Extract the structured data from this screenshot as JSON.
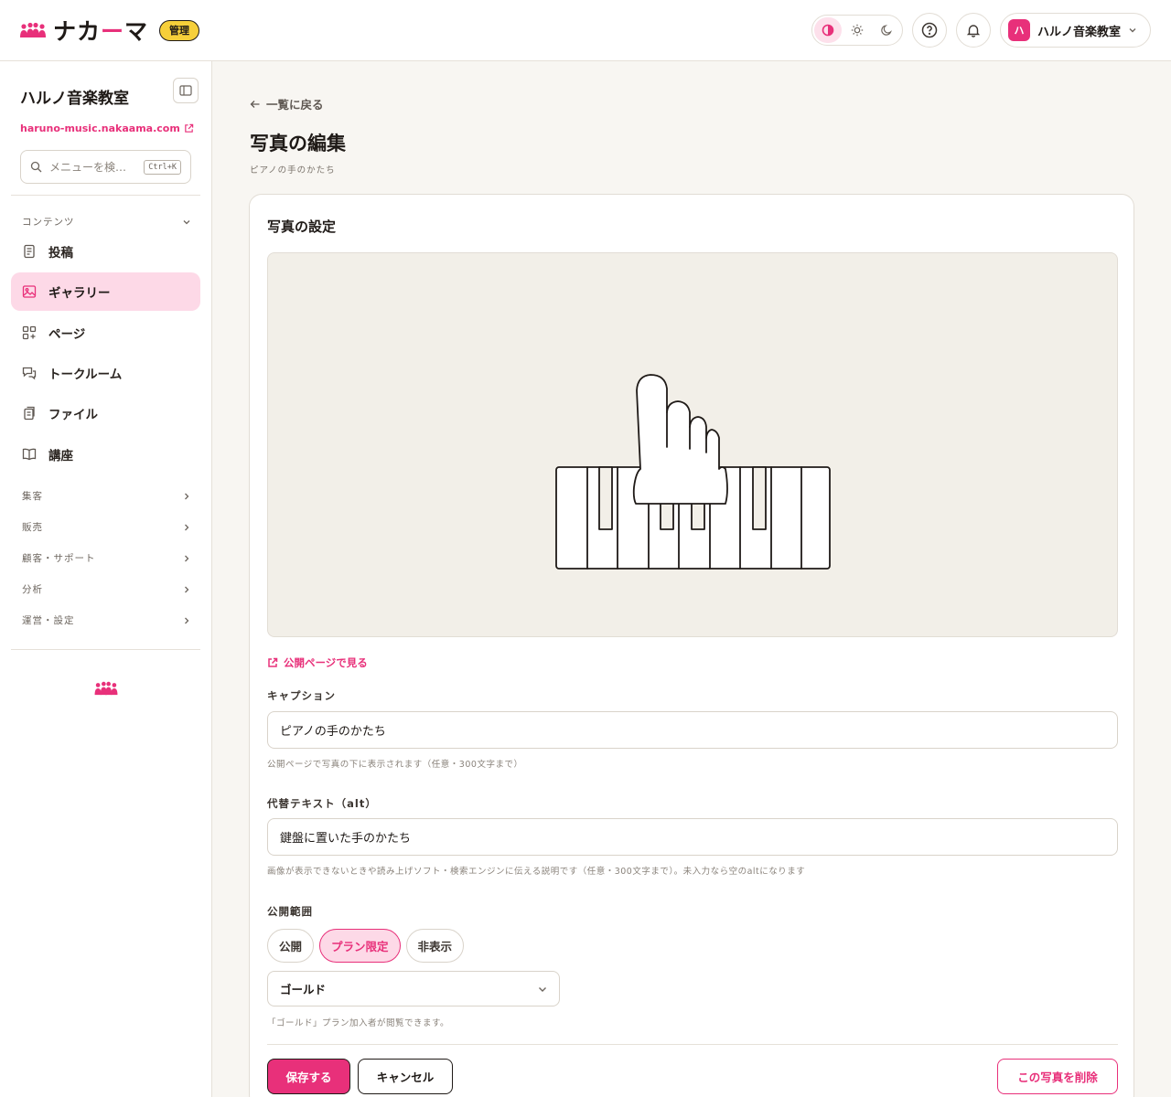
{
  "topbar": {
    "brand_name_main": "ナカ",
    "brand_name_bar": "ー",
    "brand_name_end": "マ",
    "admin_badge": "管理",
    "account_initial": "ハ",
    "account_name": "ハルノ音楽教室",
    "theme_options": [
      "contrast-icon",
      "sun-icon",
      "moon-icon"
    ],
    "accent_color": "#e8307a"
  },
  "sidebar": {
    "site_title": "ハルノ音楽教室",
    "site_url": "haruno-music.nakaama.com",
    "search_placeholder": "メニューを検…",
    "search_shortcut": "Ctrl+K",
    "section_contents": "コンテンツ",
    "items": [
      {
        "label": "投稿",
        "icon": "document-icon"
      },
      {
        "label": "ギャラリー",
        "icon": "image-icon",
        "active": true
      },
      {
        "label": "ページ",
        "icon": "pages-icon"
      },
      {
        "label": "トークルーム",
        "icon": "chat-icon"
      },
      {
        "label": "ファイル",
        "icon": "files-icon"
      },
      {
        "label": "講座",
        "icon": "book-icon"
      }
    ],
    "sections": [
      "集客",
      "販売",
      "顧客・サポート",
      "分析",
      "運営・設定"
    ]
  },
  "main": {
    "back_label": "一覧に戻る",
    "title": "写真の編集",
    "subtitle": "ピアノの手のかたち",
    "card_title": "写真の設定",
    "public_link": "公開ページで見る",
    "caption_label": "キャプション",
    "caption_value": "ピアノの手のかたち",
    "caption_help": "公開ページで写真の下に表示されます（任意・300文字まで）",
    "alt_label": "代替テキスト（alt）",
    "alt_value": "鍵盤に置いた手のかたち",
    "alt_help": "画像が表示できないときや読み上げソフト・検索エンジンに伝える説明です（任意・300文字まで）。未入力なら空のaltになります",
    "visibility_label": "公開範囲",
    "visibility_options": [
      "公開",
      "プラン限定",
      "非表示"
    ],
    "visibility_selected": "プラン限定",
    "plan_selected": "ゴールド",
    "plan_help": "「ゴールド」プラン加入者が閲覧できます。",
    "save_label": "保存する",
    "cancel_label": "キャンセル",
    "delete_label": "この写真を削除"
  }
}
